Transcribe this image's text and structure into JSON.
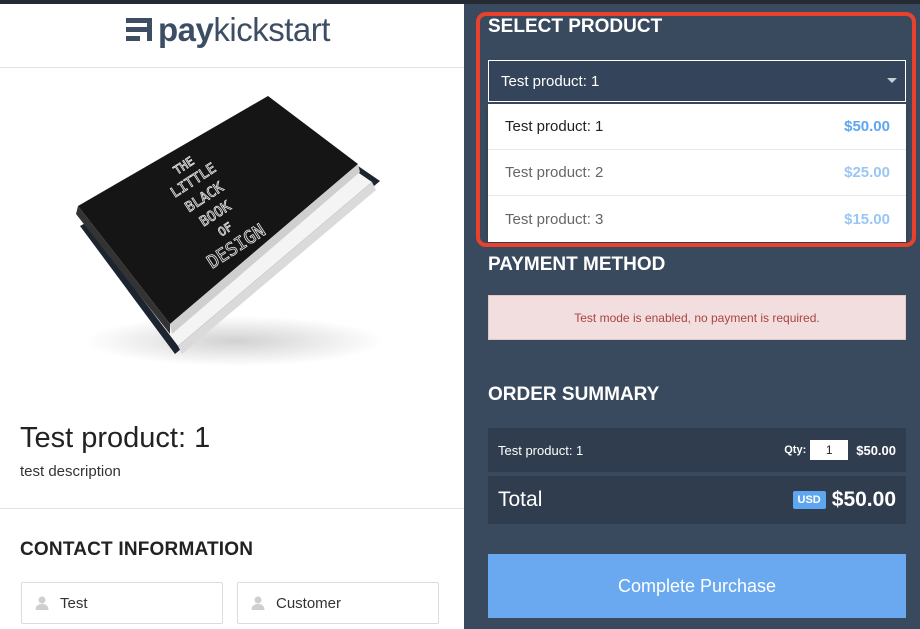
{
  "brand": {
    "logo_pay": "pay",
    "logo_kick": "kickstart"
  },
  "product": {
    "title": "Test product: 1",
    "description": "test description"
  },
  "contact": {
    "title": "CONTACT INFORMATION",
    "first_name": "Test",
    "last_name": "Customer"
  },
  "select_product": {
    "title": "SELECT PRODUCT",
    "selected": "Test product: 1",
    "options": [
      {
        "name": "Test product: 1",
        "price": "$50.00"
      },
      {
        "name": "Test product: 2",
        "price": "$25.00"
      },
      {
        "name": "Test product: 3",
        "price": "$15.00"
      }
    ]
  },
  "payment": {
    "title": "PAYMENT METHOD",
    "notice": "Test mode is enabled, no payment is required."
  },
  "summary": {
    "title": "ORDER SUMMARY",
    "item_name": "Test product: 1",
    "qty_label": "Qty:",
    "qty_value": "1",
    "item_price": "$50.00",
    "total_label": "Total",
    "currency": "USD",
    "total_amount": "$50.00"
  },
  "cta": {
    "label": "Complete Purchase"
  },
  "book_cover": {
    "title_lines": [
      "THE",
      "LITTLE",
      "BLACK",
      "BOOK",
      "OF",
      "DESIGN"
    ]
  },
  "colors": {
    "panel_bg": "#3a4a5e",
    "accent_blue": "#6aa9f0",
    "highlight_red": "#e8422f",
    "alert_bg": "#f2dede"
  }
}
